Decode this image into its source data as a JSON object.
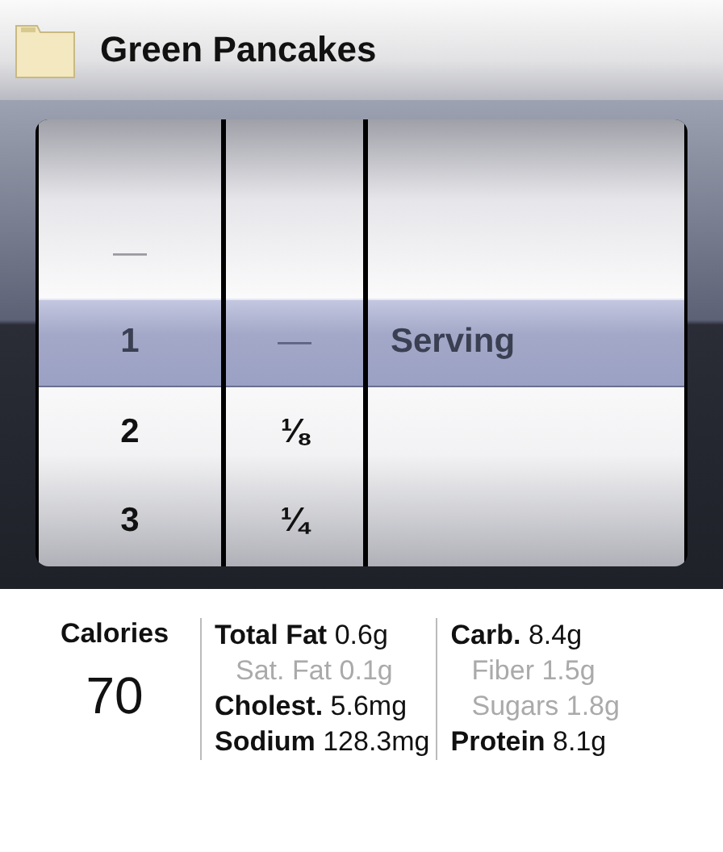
{
  "header": {
    "title": "Green Pancakes"
  },
  "wheels": [
    {
      "items": [
        {
          "text": "—",
          "selected": false,
          "disabled": true
        },
        {
          "text": "1",
          "selected": true,
          "disabled": false
        },
        {
          "text": "2",
          "selected": false,
          "disabled": false
        },
        {
          "text": "3",
          "selected": false,
          "disabled": false
        }
      ]
    },
    {
      "items": [
        {
          "text": "—",
          "selected": true,
          "disabled": true
        },
        {
          "text": "⅛",
          "selected": false,
          "disabled": false
        },
        {
          "text": "¼",
          "selected": false,
          "disabled": false
        }
      ]
    },
    {
      "items": [
        {
          "text": "Serving",
          "selected": true,
          "disabled": false
        }
      ]
    }
  ],
  "nutrition": {
    "calories": {
      "label": "Calories",
      "value": "70"
    },
    "columns": [
      [
        {
          "label": "Total Fat",
          "value": "0.6g",
          "sub": false
        },
        {
          "label": "Sat. Fat",
          "value": "0.1g",
          "sub": true
        },
        {
          "label": "Cholest.",
          "value": "5.6mg",
          "sub": false
        },
        {
          "label": "Sodium",
          "value": "128.3mg",
          "sub": false
        }
      ],
      [
        {
          "label": "Carb.",
          "value": "8.4g",
          "sub": false
        },
        {
          "label": "Fiber",
          "value": "1.5g",
          "sub": true
        },
        {
          "label": "Sugars",
          "value": "1.8g",
          "sub": true
        },
        {
          "label": "Protein",
          "value": "8.1g",
          "sub": false
        }
      ]
    ]
  }
}
